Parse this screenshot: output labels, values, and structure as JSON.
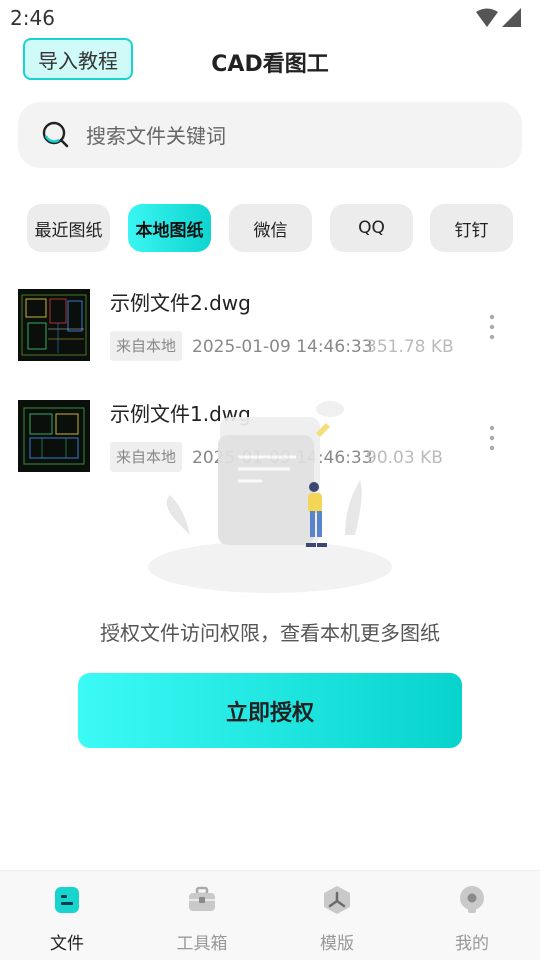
{
  "status_bar": {
    "time": "2:46"
  },
  "header": {
    "tutorial_label": "导入教程",
    "title": "CAD看图工"
  },
  "search": {
    "placeholder": "搜索文件关键词"
  },
  "tabs": [
    {
      "label": "最近图纸",
      "active": false
    },
    {
      "label": "本地图纸",
      "active": true
    },
    {
      "label": "微信",
      "active": false
    },
    {
      "label": "QQ",
      "active": false
    },
    {
      "label": "钉钉",
      "active": false
    }
  ],
  "files": [
    {
      "name": "示例文件2.dwg",
      "source": "来自本地",
      "time": "2025-01-09 14:46:33",
      "size": "351.78 KB"
    },
    {
      "name": "示例文件1.dwg",
      "source": "来自本地",
      "time": "2025-01-09 14:46:33",
      "size": "90.03 KB"
    }
  ],
  "permission": {
    "hint": "授权文件访问权限，查看本机更多图纸",
    "button_label": "立即授权"
  },
  "bottom_nav": [
    {
      "label": "文件",
      "icon": "file-icon",
      "active": true
    },
    {
      "label": "工具箱",
      "icon": "toolbox-icon",
      "active": false
    },
    {
      "label": "模版",
      "icon": "template-icon",
      "active": false
    },
    {
      "label": "我的",
      "icon": "profile-icon",
      "active": false
    }
  ],
  "colors": {
    "accent": "#0fd4cf",
    "accent_light": "#cffaf7"
  }
}
